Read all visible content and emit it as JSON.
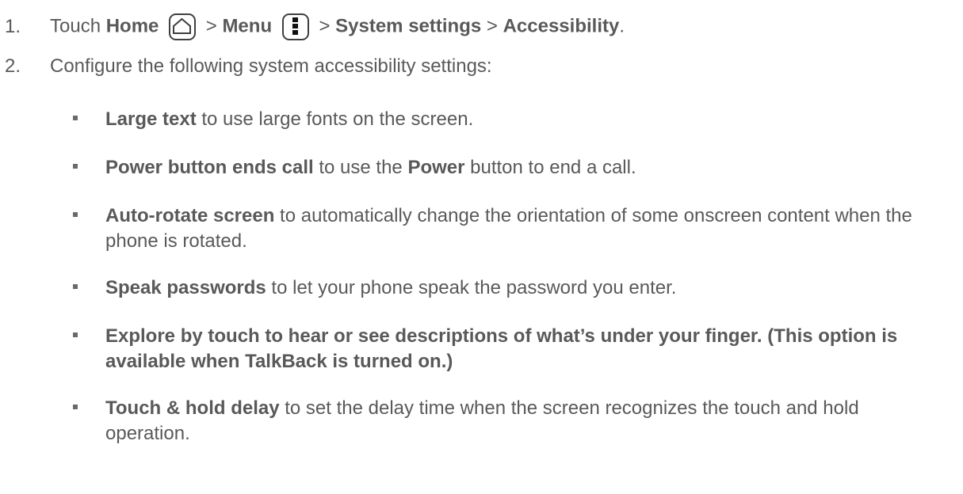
{
  "step1": {
    "number": "1.",
    "touch": "Touch",
    "home": "Home",
    "sep1": ">",
    "menu": "Menu",
    "sep2": ">",
    "system_settings": "System settings",
    "sep3": ">",
    "accessibility": "Accessibility",
    "end": "."
  },
  "step2": {
    "number": "2.",
    "text": "Configure the following system accessibility settings:"
  },
  "bullets": [
    {
      "bold": "Large text",
      "rest": " to use large fonts on the screen."
    },
    {
      "bold": "Power button ends call",
      "mid": " to use the ",
      "bold2": "Power",
      "rest": " button to end a call."
    },
    {
      "bold": "Auto-rotate screen",
      "rest": " to automatically change the orientation of some onscreen content when the phone is rotated."
    },
    {
      "bold": "Speak passwords",
      "rest": " to let your phone speak the password you enter."
    },
    {
      "bold": "Explore by touch to hear or see descriptions of what’s under your finger. (This option is available when TalkBack is turned on.)"
    },
    {
      "bold": "Touch & hold delay",
      "rest": " to set the delay time when the screen recognizes the touch and hold operation."
    }
  ],
  "icons": {
    "home": "home-icon",
    "menu": "menu-icon"
  }
}
